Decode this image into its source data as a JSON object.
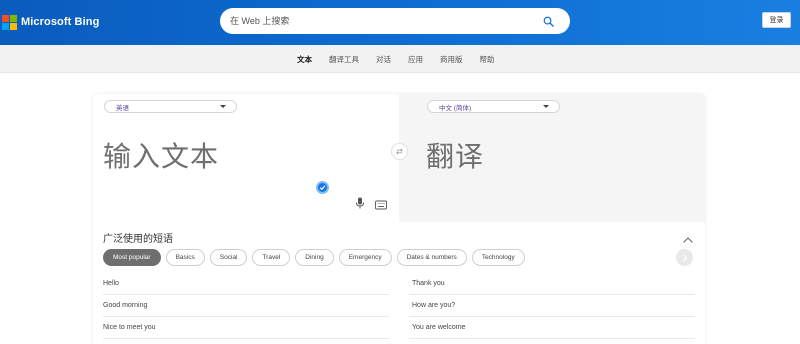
{
  "header": {
    "logo_text": "Microsoft Bing",
    "logo_colors": [
      "#f25022",
      "#7fba00",
      "#00a4ef",
      "#ffb900"
    ],
    "search_placeholder": "在 Web 上搜索",
    "signin_label": "登录"
  },
  "nav": {
    "items": [
      {
        "label": "文本",
        "active": true
      },
      {
        "label": "翻译工具",
        "active": false
      },
      {
        "label": "对话",
        "active": false
      },
      {
        "label": "应用",
        "active": false
      },
      {
        "label": "商用版",
        "active": false
      },
      {
        "label": "帮助",
        "active": false
      }
    ]
  },
  "translator": {
    "source_language": "英语",
    "target_language": "中文 (简体)",
    "source_placeholder": "输入文本",
    "target_placeholder": "翻译"
  },
  "phrases": {
    "heading": "广泛使用的短语",
    "categories": [
      {
        "label": "Most popular",
        "active": true
      },
      {
        "label": "Basics",
        "active": false
      },
      {
        "label": "Social",
        "active": false
      },
      {
        "label": "Travel",
        "active": false
      },
      {
        "label": "Dining",
        "active": false
      },
      {
        "label": "Emergency",
        "active": false
      },
      {
        "label": "Dates & numbers",
        "active": false
      },
      {
        "label": "Technology",
        "active": false
      }
    ],
    "rows": [
      {
        "left": "Hello",
        "right": "Thank you"
      },
      {
        "left": "Good morning",
        "right": "How are you?"
      },
      {
        "left": "Nice to meet you",
        "right": "You are welcome"
      }
    ]
  },
  "colors": {
    "header_blue": "#0e6ed3",
    "accent_blue": "#1a73e8",
    "language_text": "#5a3fa3"
  }
}
